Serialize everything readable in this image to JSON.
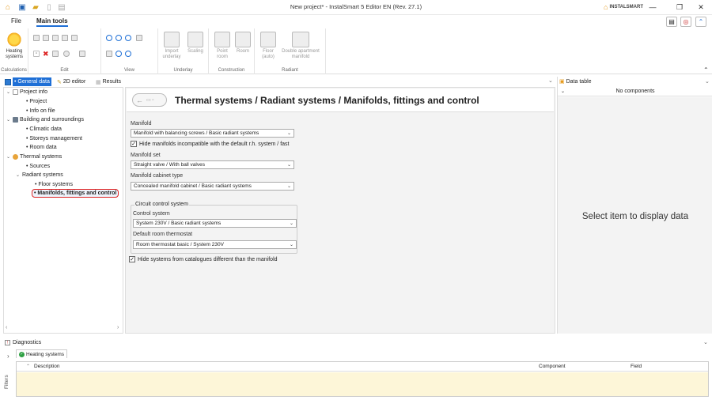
{
  "window": {
    "title": "New project* - InstalSmart 5 Editor EN (Rev. 27.1)",
    "brand": "INSTALSMART",
    "controls": {
      "minimize": "—",
      "maximize": "❐",
      "close": "✕"
    }
  },
  "menu": {
    "file": "File",
    "main_tools": "Main tools"
  },
  "ribbon": {
    "groups": {
      "calculations": "Calculations",
      "edit": "Edit",
      "view": "View",
      "underlay": "Underlay",
      "construction": "Construction",
      "radiant": "Radiant"
    },
    "buttons": {
      "heating_systems_line1": "Heating",
      "heating_systems_line2": "systems",
      "import_underlay_line1": "Import",
      "import_underlay_line2": "underlay",
      "scaling": "Scaling",
      "point_room_line1": "Point",
      "point_room_line2": "room",
      "room": "Room",
      "floor_auto_line1": "Floor",
      "floor_auto_line2": "(auto)",
      "double_apartment_line1": "Double apartment",
      "double_apartment_line2": "manifold"
    }
  },
  "tabs": {
    "general": "• General data",
    "editor2d": "2D editor",
    "results": "Results"
  },
  "tree": {
    "project_info": "Project info",
    "project": "• Project",
    "info_on_file": "• Info on file",
    "building": "Building and surroundings",
    "climatic": "• Climatic data",
    "storeys": "• Storeys management",
    "room_data": "• Room data",
    "thermal": "Thermal systems",
    "sources": "• Sources",
    "radiant": "Radiant systems",
    "floor_systems": "• Floor systems",
    "manifolds": "• Manifolds, fittings and control"
  },
  "main": {
    "title": "Thermal systems / Radiant systems / Manifolds, fittings and control",
    "manifold_label": "Manifold",
    "manifold_value": "Manifold with balancing screws / Basic radiant systems",
    "hide_incompatible": "Hide manifolds incompatible with the default r.h. system / fast",
    "manifold_set_label": "Manifold set",
    "manifold_set_value": "Straight valve / With ball valves",
    "cabinet_label": "Manifold cabinet type",
    "cabinet_value": "Concealed manifold cabinet / Basic radiant systems",
    "circuit_legend": "Circuit control system",
    "control_label": "Control system",
    "control_value": "System 230V / Basic radiant systems",
    "thermostat_label": "Default room thermostat",
    "thermostat_value": "Room thermostat basic / System 230V",
    "hide_catalogues": "Hide systems from catalogues different than the manifold"
  },
  "data_panel": {
    "title": "Data table",
    "no_components": "No components",
    "message": "Select item to display data"
  },
  "diagnostics": {
    "title": "Diagnostics",
    "tab": "Heating systems",
    "col_description": "Description",
    "col_component": "Component",
    "col_field": "Field",
    "filters": "Filters"
  }
}
